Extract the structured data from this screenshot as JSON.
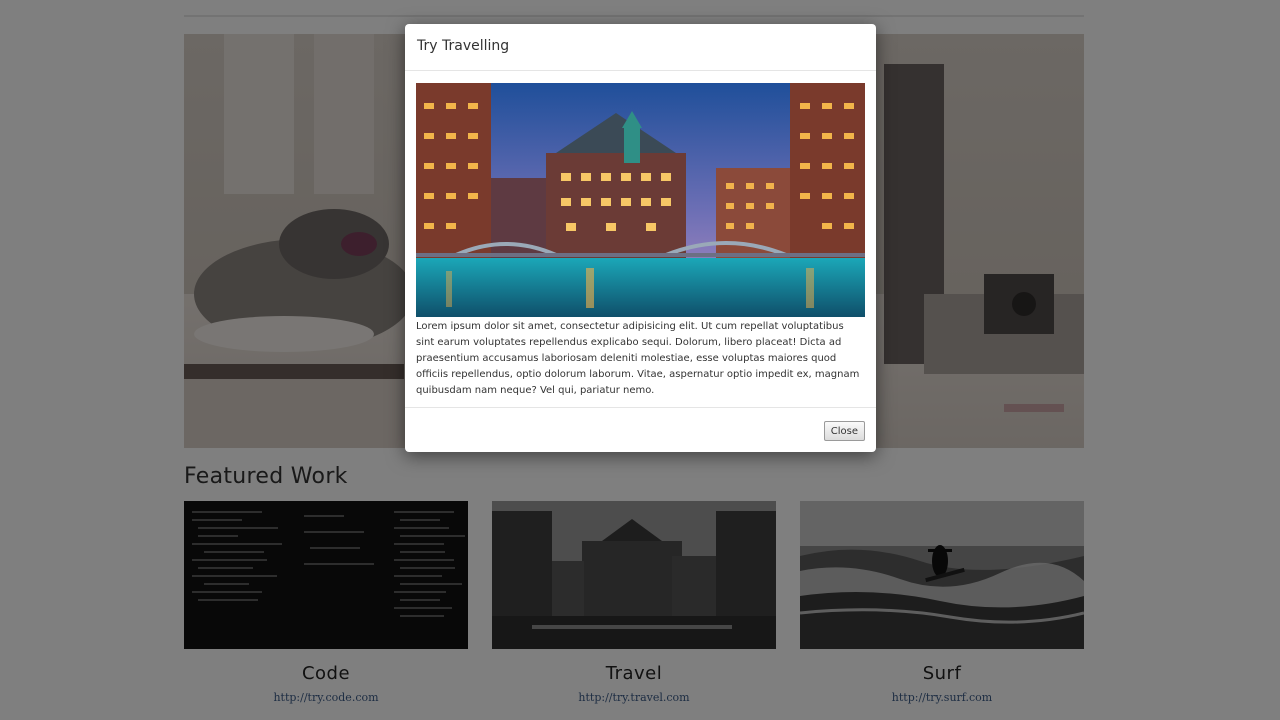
{
  "main": {
    "section_title": "Featured Work",
    "cards": [
      {
        "title": "Code",
        "link": "http://try.code.com",
        "image": "code-screen-thumbnail"
      },
      {
        "title": "Travel",
        "link": "http://try.travel.com",
        "image": "canal-city-thumbnail"
      },
      {
        "title": "Surf",
        "link": "http://try.surf.com",
        "image": "surfer-thumbnail"
      }
    ]
  },
  "modal": {
    "title": "Try Travelling",
    "image": "canal-city-colour-photo",
    "body": "Lorem ipsum dolor sit amet, consectetur adipisicing elit. Ut cum repellat voluptatibus sint earum voluptates repellendus explicabo sequi. Dolorum, libero placeat! Dicta ad praesentium accusamus laboriosam deleniti molestiae, esse voluptas maiores quod officiis repellendus, optio dolorum laborum. Vitae, aspernatur optio impedit ex, magnam quibusdam nam neque? Vel qui, pariatur nemo.",
    "close_label": "Close"
  }
}
